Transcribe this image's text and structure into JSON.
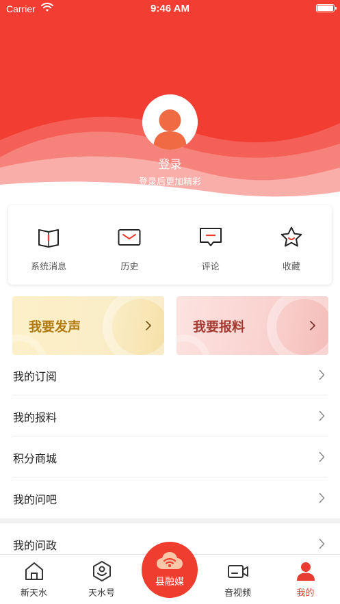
{
  "status_bar": {
    "carrier": "Carrier",
    "time": "9:46 AM"
  },
  "profile": {
    "login_label": "登录",
    "login_hint": "登录后更加精彩"
  },
  "quick_actions": [
    {
      "label": "系统消息",
      "icon": "book-icon"
    },
    {
      "label": "历史",
      "icon": "envelope-icon"
    },
    {
      "label": "评论",
      "icon": "comment-icon"
    },
    {
      "label": "收藏",
      "icon": "star-icon"
    }
  ],
  "banners": {
    "voice": "我要发声",
    "report": "我要报料"
  },
  "menu": [
    {
      "label": "我的订阅"
    },
    {
      "label": "我的报料"
    },
    {
      "label": "积分商城"
    },
    {
      "label": "我的问吧"
    },
    {
      "label": "我的问政"
    }
  ],
  "tabbar": {
    "items": [
      {
        "label": "新天水",
        "icon": "home-icon"
      },
      {
        "label": "天水号",
        "icon": "hexagon-user-icon"
      },
      {
        "label": "县融媒",
        "icon": "cloud-signal-icon"
      },
      {
        "label": "音视频",
        "icon": "video-camera-icon"
      },
      {
        "label": "我的",
        "icon": "user-icon"
      }
    ],
    "active_color": "#e73c31"
  },
  "colors": {
    "brand_red": "#f23d32",
    "voice_text": "#b07a12",
    "report_text": "#a53a33"
  }
}
